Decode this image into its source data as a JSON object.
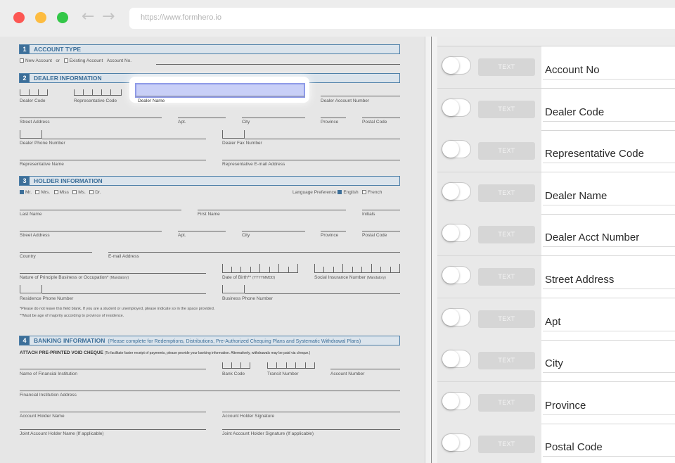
{
  "browser": {
    "url": "https://www.formhero.io",
    "back_icon": "←",
    "forward_icon": "→"
  },
  "form": {
    "sections": [
      {
        "num": "1",
        "title": "ACCOUNT TYPE",
        "note": ""
      },
      {
        "num": "2",
        "title": "DEALER INFORMATION",
        "note": ""
      },
      {
        "num": "3",
        "title": "HOLDER INFORMATION",
        "note": ""
      },
      {
        "num": "4",
        "title": "BANKING INFORMATION",
        "note": "(Please complete for Redemptions, Distributions, Pre-Authorized Chequing Plans and Systematic Withdrawal Plans)"
      }
    ],
    "account_type": {
      "new": "New Account",
      "or": "or",
      "existing": "Existing Account",
      "account_no": "Account No."
    },
    "dealer": {
      "dealer_code": "Dealer Code",
      "rep_code": "Representative Code",
      "dealer_name": "Dealer Name",
      "dealer_account_number": "Dealer Account Number",
      "street_address": "Street Address",
      "apt": "Apt.",
      "city": "City",
      "province": "Province",
      "postal_code": "Postal Code",
      "phone": "Dealer Phone Number",
      "fax": "Dealer Fax Number",
      "rep_name": "Representative Name",
      "rep_email": "Representative E-mail Address"
    },
    "holder": {
      "titles": [
        "Mr.",
        "Mrs.",
        "Miss",
        "Ms.",
        "Dr."
      ],
      "lang_label": "Language Preference",
      "lang_english": "English",
      "lang_french": "French",
      "last_name": "Last Name",
      "first_name": "First Name",
      "initials": "Initials",
      "street_address": "Street Address",
      "apt": "Apt.",
      "city": "City",
      "province": "Province",
      "postal_code": "Postal Code",
      "country": "Country",
      "email": "E-mail Address",
      "occupation": "Nature of Principle Business or Occupation*",
      "mandatory": "(Mandatory)",
      "dob": "Date of Birth**",
      "dob_format": "(YYYYMMDD)",
      "sin": "Social Insurance Number",
      "res_phone": "Residence Phone Number",
      "bus_phone": "Business Phone Number",
      "note1": "*Please do not leave this field blank. If you are a student or unemployed, please indicate so in the space provided.",
      "note2": "**Must be age of majority according to province of residence."
    },
    "banking": {
      "attach": "ATTACH PRE-PRINTED VOID CHEQUE",
      "attach_note": "(To facilitate faster receipt of payments, please provide your banking information. Alternatively, withdrawals may be paid via cheque.)",
      "institution": "Name of Financial Institution",
      "bank_code": "Bank Code",
      "transit": "Transit Number",
      "account_number": "Account Number",
      "institution_address": "Financial Institution Address",
      "holder_name": "Account Holder Name",
      "holder_signature": "Account Holder Signature",
      "joint_name": "Joint Account Holder Name (If applicable)",
      "joint_signature": "Joint Account Holder Signature (If applicable)"
    }
  },
  "panel": {
    "fields": [
      {
        "type": "TEXT",
        "label": "Account No"
      },
      {
        "type": "TEXT",
        "label": "Dealer Code"
      },
      {
        "type": "TEXT",
        "label": "Representative Code"
      },
      {
        "type": "TEXT",
        "label": "Dealer Name"
      },
      {
        "type": "TEXT",
        "label": "Dealer Acct Number"
      },
      {
        "type": "TEXT",
        "label": "Street Address"
      },
      {
        "type": "TEXT",
        "label": "Apt"
      },
      {
        "type": "TEXT",
        "label": "City"
      },
      {
        "type": "TEXT",
        "label": "Province"
      },
      {
        "type": "TEXT",
        "label": "Postal Code"
      }
    ]
  }
}
